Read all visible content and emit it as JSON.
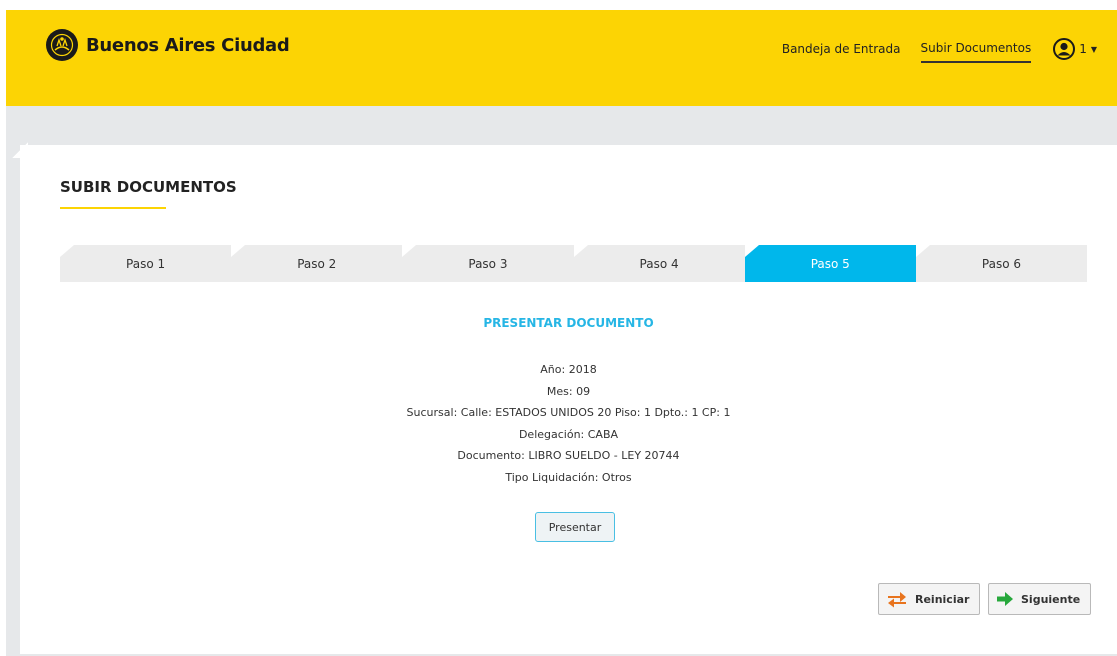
{
  "header": {
    "brand": "Buenos Aires Ciudad",
    "nav": [
      {
        "label": "Bandeja de Entrada",
        "active": false
      },
      {
        "label": "Subir Documentos",
        "active": true
      }
    ],
    "user_label": "1",
    "brand_color": "#fcd404"
  },
  "page": {
    "title": "SUBIR DOCUMENTOS"
  },
  "steps": [
    {
      "label": "Paso 1",
      "active": false
    },
    {
      "label": "Paso 2",
      "active": false
    },
    {
      "label": "Paso 3",
      "active": false
    },
    {
      "label": "Paso 4",
      "active": false
    },
    {
      "label": "Paso 5",
      "active": true
    },
    {
      "label": "Paso 6",
      "active": false
    }
  ],
  "document": {
    "title": "PRESENTAR DOCUMENTO",
    "details": [
      "Año: 2018",
      "Mes: 09",
      "Sucursal: Calle: ESTADOS UNIDOS 20 Piso: 1 Dpto.: 1 CP: 1",
      "Delegación: CABA",
      "Documento: LIBRO SUELDO - LEY 20744",
      "Tipo Liquidación: Otros"
    ],
    "submit_label": "Presentar"
  },
  "actions": {
    "reset_label": "Reiniciar",
    "reset_icon": "swap-arrows-icon",
    "next_label": "Siguiente",
    "next_icon": "arrow-right-icon"
  },
  "colors": {
    "accent": "#00b7eb",
    "title_blue": "#26b6e5"
  }
}
